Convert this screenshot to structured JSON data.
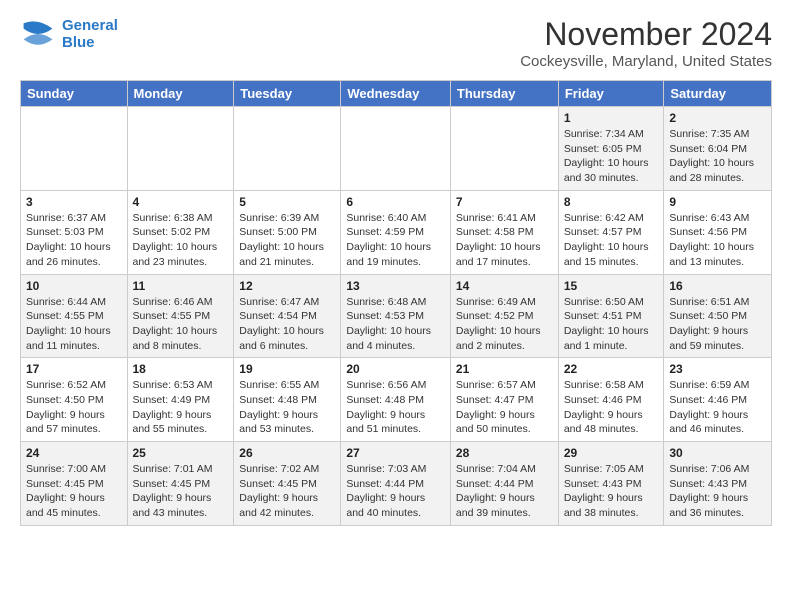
{
  "logo": {
    "line1": "General",
    "line2": "Blue"
  },
  "title": "November 2024",
  "location": "Cockeysville, Maryland, United States",
  "weekdays": [
    "Sunday",
    "Monday",
    "Tuesday",
    "Wednesday",
    "Thursday",
    "Friday",
    "Saturday"
  ],
  "weeks": [
    [
      {
        "day": "",
        "info": ""
      },
      {
        "day": "",
        "info": ""
      },
      {
        "day": "",
        "info": ""
      },
      {
        "day": "",
        "info": ""
      },
      {
        "day": "",
        "info": ""
      },
      {
        "day": "1",
        "info": "Sunrise: 7:34 AM\nSunset: 6:05 PM\nDaylight: 10 hours and 30 minutes."
      },
      {
        "day": "2",
        "info": "Sunrise: 7:35 AM\nSunset: 6:04 PM\nDaylight: 10 hours and 28 minutes."
      }
    ],
    [
      {
        "day": "3",
        "info": "Sunrise: 6:37 AM\nSunset: 5:03 PM\nDaylight: 10 hours and 26 minutes."
      },
      {
        "day": "4",
        "info": "Sunrise: 6:38 AM\nSunset: 5:02 PM\nDaylight: 10 hours and 23 minutes."
      },
      {
        "day": "5",
        "info": "Sunrise: 6:39 AM\nSunset: 5:00 PM\nDaylight: 10 hours and 21 minutes."
      },
      {
        "day": "6",
        "info": "Sunrise: 6:40 AM\nSunset: 4:59 PM\nDaylight: 10 hours and 19 minutes."
      },
      {
        "day": "7",
        "info": "Sunrise: 6:41 AM\nSunset: 4:58 PM\nDaylight: 10 hours and 17 minutes."
      },
      {
        "day": "8",
        "info": "Sunrise: 6:42 AM\nSunset: 4:57 PM\nDaylight: 10 hours and 15 minutes."
      },
      {
        "day": "9",
        "info": "Sunrise: 6:43 AM\nSunset: 4:56 PM\nDaylight: 10 hours and 13 minutes."
      }
    ],
    [
      {
        "day": "10",
        "info": "Sunrise: 6:44 AM\nSunset: 4:55 PM\nDaylight: 10 hours and 11 minutes."
      },
      {
        "day": "11",
        "info": "Sunrise: 6:46 AM\nSunset: 4:55 PM\nDaylight: 10 hours and 8 minutes."
      },
      {
        "day": "12",
        "info": "Sunrise: 6:47 AM\nSunset: 4:54 PM\nDaylight: 10 hours and 6 minutes."
      },
      {
        "day": "13",
        "info": "Sunrise: 6:48 AM\nSunset: 4:53 PM\nDaylight: 10 hours and 4 minutes."
      },
      {
        "day": "14",
        "info": "Sunrise: 6:49 AM\nSunset: 4:52 PM\nDaylight: 10 hours and 2 minutes."
      },
      {
        "day": "15",
        "info": "Sunrise: 6:50 AM\nSunset: 4:51 PM\nDaylight: 10 hours and 1 minute."
      },
      {
        "day": "16",
        "info": "Sunrise: 6:51 AM\nSunset: 4:50 PM\nDaylight: 9 hours and 59 minutes."
      }
    ],
    [
      {
        "day": "17",
        "info": "Sunrise: 6:52 AM\nSunset: 4:50 PM\nDaylight: 9 hours and 57 minutes."
      },
      {
        "day": "18",
        "info": "Sunrise: 6:53 AM\nSunset: 4:49 PM\nDaylight: 9 hours and 55 minutes."
      },
      {
        "day": "19",
        "info": "Sunrise: 6:55 AM\nSunset: 4:48 PM\nDaylight: 9 hours and 53 minutes."
      },
      {
        "day": "20",
        "info": "Sunrise: 6:56 AM\nSunset: 4:48 PM\nDaylight: 9 hours and 51 minutes."
      },
      {
        "day": "21",
        "info": "Sunrise: 6:57 AM\nSunset: 4:47 PM\nDaylight: 9 hours and 50 minutes."
      },
      {
        "day": "22",
        "info": "Sunrise: 6:58 AM\nSunset: 4:46 PM\nDaylight: 9 hours and 48 minutes."
      },
      {
        "day": "23",
        "info": "Sunrise: 6:59 AM\nSunset: 4:46 PM\nDaylight: 9 hours and 46 minutes."
      }
    ],
    [
      {
        "day": "24",
        "info": "Sunrise: 7:00 AM\nSunset: 4:45 PM\nDaylight: 9 hours and 45 minutes."
      },
      {
        "day": "25",
        "info": "Sunrise: 7:01 AM\nSunset: 4:45 PM\nDaylight: 9 hours and 43 minutes."
      },
      {
        "day": "26",
        "info": "Sunrise: 7:02 AM\nSunset: 4:45 PM\nDaylight: 9 hours and 42 minutes."
      },
      {
        "day": "27",
        "info": "Sunrise: 7:03 AM\nSunset: 4:44 PM\nDaylight: 9 hours and 40 minutes."
      },
      {
        "day": "28",
        "info": "Sunrise: 7:04 AM\nSunset: 4:44 PM\nDaylight: 9 hours and 39 minutes."
      },
      {
        "day": "29",
        "info": "Sunrise: 7:05 AM\nSunset: 4:43 PM\nDaylight: 9 hours and 38 minutes."
      },
      {
        "day": "30",
        "info": "Sunrise: 7:06 AM\nSunset: 4:43 PM\nDaylight: 9 hours and 36 minutes."
      }
    ]
  ]
}
